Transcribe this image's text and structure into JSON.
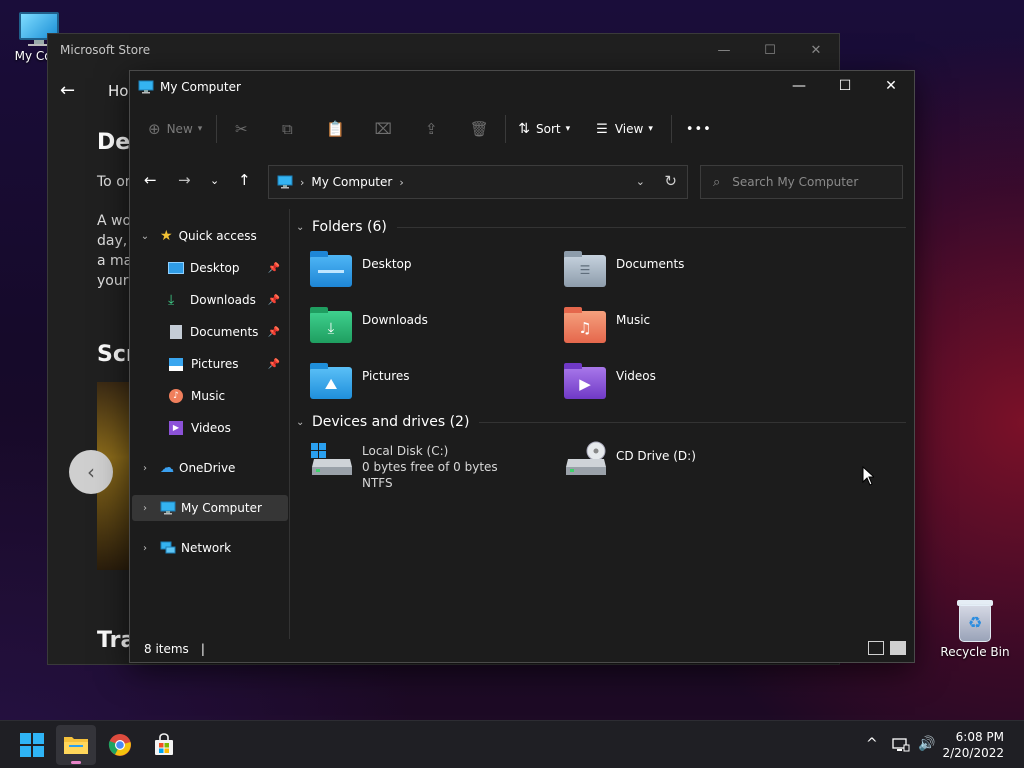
{
  "desktop": {
    "icons": [
      {
        "label": "My Com"
      },
      {
        "label": "Recycle Bin"
      }
    ]
  },
  "store": {
    "title": "Microsoft Store",
    "home_tab": "Hor",
    "heading1": "Des",
    "para1": "To or",
    "para2_lines": [
      "A wo",
      "day, r",
      "a mas",
      "your"
    ],
    "heading2": "Scr",
    "heading3": "Tra",
    "carousel_prev": "‹"
  },
  "explorer": {
    "title": "My Computer",
    "window_buttons": {
      "minimize": "—",
      "maximize": "☐",
      "close": "✕"
    },
    "toolbar": {
      "new_label": "New",
      "sort_label": "Sort",
      "view_label": "View",
      "more": "•••"
    },
    "address": {
      "separator": "›",
      "location": "My Computer"
    },
    "search": {
      "placeholder": "Search My Computer"
    },
    "sidebar": {
      "quick_access": "Quick access",
      "quick_items": [
        {
          "label": "Desktop",
          "icon": "desktop-icon"
        },
        {
          "label": "Downloads",
          "icon": "download-icon"
        },
        {
          "label": "Documents",
          "icon": "document-icon"
        },
        {
          "label": "Pictures",
          "icon": "picture-icon"
        },
        {
          "label": "Music",
          "icon": "music-icon"
        },
        {
          "label": "Videos",
          "icon": "video-icon"
        }
      ],
      "onedrive": "OneDrive",
      "my_computer": "My Computer",
      "network": "Network"
    },
    "groups": {
      "folders": {
        "title": "Folders (6)",
        "items": [
          {
            "name": "Desktop",
            "color": "#2f9ce6",
            "icon": "desktop-folder-icon"
          },
          {
            "name": "Documents",
            "color": "#a9b8c8",
            "icon": "documents-folder-icon"
          },
          {
            "name": "Downloads",
            "color": "#2ebd7a",
            "icon": "downloads-folder-icon"
          },
          {
            "name": "Music",
            "color": "#f07f5c",
            "icon": "music-folder-icon"
          },
          {
            "name": "Pictures",
            "color": "#36a7ee",
            "icon": "pictures-folder-icon"
          },
          {
            "name": "Videos",
            "color": "#8c52d8",
            "icon": "videos-folder-icon"
          }
        ]
      },
      "drives": {
        "title": "Devices and drives (2)",
        "items": [
          {
            "name": "Local Disk (C:)",
            "free": "0 bytes free of 0 bytes",
            "fs": "NTFS",
            "icon": "hard-disk-icon"
          },
          {
            "name": "CD Drive (D:)",
            "icon": "cd-drive-icon"
          }
        ]
      }
    },
    "status": {
      "items": "8 items",
      "bar": "|"
    }
  },
  "taskbar": {
    "clock_time": "6:08 PM",
    "clock_date": "2/20/2022",
    "tray_chevron": "^"
  }
}
